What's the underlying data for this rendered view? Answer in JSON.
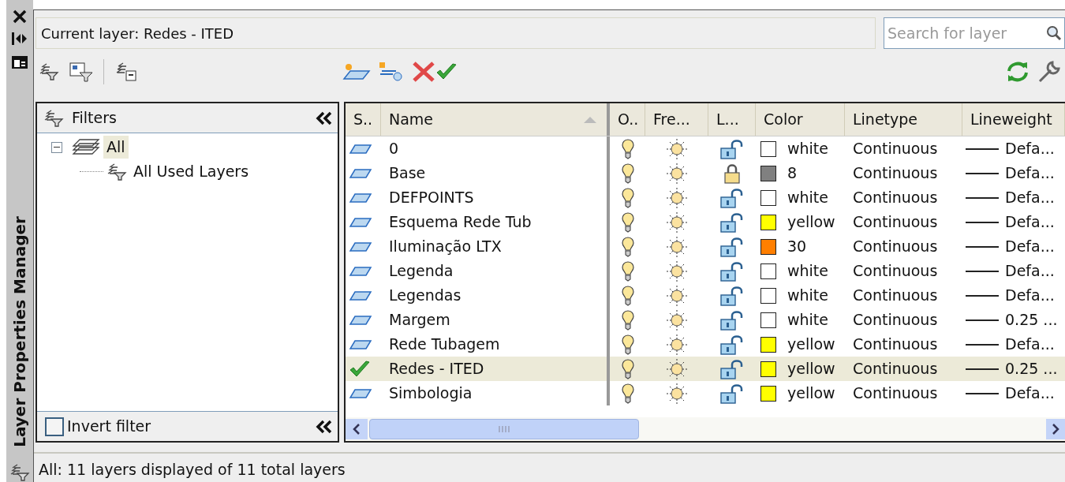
{
  "sidebar": {
    "title": "Layer Properties Manager"
  },
  "current_layer": "Current layer: Redes - ITED",
  "search": {
    "placeholder": "Search for layer"
  },
  "filters": {
    "title": "Filters",
    "tree": [
      {
        "label": "All",
        "selected": true,
        "expanded": true,
        "children": [
          {
            "label": "All Used Layers",
            "selected": false
          }
        ]
      }
    ],
    "invert_filter": {
      "label": "Invert filter",
      "checked": false
    }
  },
  "table": {
    "columns": [
      "S..",
      "Name",
      "O..",
      "Fre...",
      "L...",
      "Color",
      "Linetype",
      "Lineweight"
    ],
    "rows": [
      {
        "current": false,
        "selected": false,
        "name": "0",
        "on": true,
        "frozen": false,
        "locked": false,
        "color": "#ffffff",
        "color_name": "white",
        "linetype": "Continuous",
        "lineweight": "Defa..."
      },
      {
        "current": false,
        "selected": false,
        "name": "Base",
        "on": true,
        "frozen": false,
        "locked": true,
        "color": "#808080",
        "color_name": "8",
        "linetype": "Continuous",
        "lineweight": "Defa..."
      },
      {
        "current": false,
        "selected": false,
        "name": "DEFPOINTS",
        "on": true,
        "frozen": false,
        "locked": false,
        "color": "#ffffff",
        "color_name": "white",
        "linetype": "Continuous",
        "lineweight": "Defa..."
      },
      {
        "current": false,
        "selected": false,
        "name": "Esquema Rede Tub",
        "on": true,
        "frozen": false,
        "locked": false,
        "color": "#ffff00",
        "color_name": "yellow",
        "linetype": "Continuous",
        "lineweight": "Defa..."
      },
      {
        "current": false,
        "selected": false,
        "name": "Iluminação LTX",
        "on": true,
        "frozen": false,
        "locked": false,
        "color": "#ff7f00",
        "color_name": "30",
        "linetype": "Continuous",
        "lineweight": "Defa..."
      },
      {
        "current": false,
        "selected": false,
        "name": "Legenda",
        "on": true,
        "frozen": false,
        "locked": false,
        "color": "#ffffff",
        "color_name": "white",
        "linetype": "Continuous",
        "lineweight": "Defa..."
      },
      {
        "current": false,
        "selected": false,
        "name": "Legendas",
        "on": true,
        "frozen": false,
        "locked": false,
        "color": "#ffffff",
        "color_name": "white",
        "linetype": "Continuous",
        "lineweight": "Defa..."
      },
      {
        "current": false,
        "selected": false,
        "name": "Margem",
        "on": true,
        "frozen": false,
        "locked": false,
        "color": "#ffffff",
        "color_name": "white",
        "linetype": "Continuous",
        "lineweight": "0.25 ..."
      },
      {
        "current": false,
        "selected": false,
        "name": "Rede Tubagem",
        "on": true,
        "frozen": false,
        "locked": false,
        "color": "#ffff00",
        "color_name": "yellow",
        "linetype": "Continuous",
        "lineweight": "Defa..."
      },
      {
        "current": true,
        "selected": true,
        "name": "Redes - ITED",
        "on": true,
        "frozen": false,
        "locked": false,
        "color": "#ffff00",
        "color_name": "yellow",
        "linetype": "Continuous",
        "lineweight": "0.25 ..."
      },
      {
        "current": false,
        "selected": false,
        "name": "Simbologia",
        "on": true,
        "frozen": false,
        "locked": false,
        "color": "#ffff00",
        "color_name": "yellow",
        "linetype": "Continuous",
        "lineweight": "Defa..."
      }
    ]
  },
  "status_bar": "All: 11 layers displayed of 11 total layers"
}
